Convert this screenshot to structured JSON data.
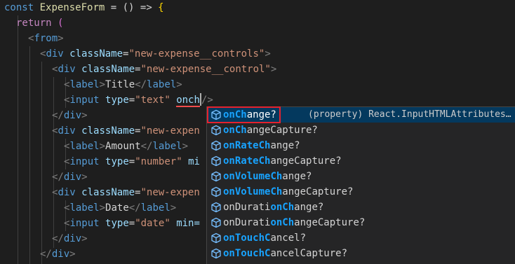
{
  "code": {
    "l1_kw": "const",
    "l1_name": "ExpenseForm",
    "l1_rest": " = () => ",
    "l1_brace": "{",
    "l2_kw": "return",
    "l2_paren": "(",
    "l3_tag": "from",
    "l4_tag": "div",
    "l4_attr": "className",
    "l4_val": "\"new-expense__controls\"",
    "l5_tag": "div",
    "l5_attr": "className",
    "l5_val": "\"new-expense__control\"",
    "l6_tag": "label",
    "l6_text": "Title",
    "l7_tag": "input",
    "l7_attr": "type",
    "l7_val": "\"text\"",
    "l7_typed": "onch",
    "l8_tag": "div",
    "l9_tag": "div",
    "l9_attr": "className",
    "l9_val": "\"new-expen",
    "l10_tag": "label",
    "l10_text": "Amount",
    "l11_tag": "input",
    "l11_attr": "type",
    "l11_val": "\"number\"",
    "l11_cut": "mi",
    "l12_tag": "div",
    "l13_tag": "div",
    "l13_attr": "className",
    "l13_val": "\"new-expen",
    "l14_tag": "label",
    "l14_text": "Date",
    "l15_tag": "input",
    "l15_attr": "type",
    "l15_val": "\"date\"",
    "l15_cut": "min=",
    "l16_tag": "div",
    "l17_tag": "div"
  },
  "suggestions": {
    "icon": "property-cube-icon",
    "detail": "(property) React.InputHTMLAttributes…",
    "items": [
      {
        "pre": "",
        "hl": "onCh",
        "post": "ange?"
      },
      {
        "pre": "",
        "hl": "onCh",
        "post": "angeCapture?"
      },
      {
        "pre": "onRate",
        "hl": "Ch",
        "post": "ange?"
      },
      {
        "pre": "onRate",
        "hl": "Ch",
        "post": "angeCapture?"
      },
      {
        "pre": "onVolume",
        "hl": "Ch",
        "post": "ange?"
      },
      {
        "pre": "onVolume",
        "hl": "Ch",
        "post": "angeCapture?"
      },
      {
        "pre": "onDurati",
        "hl": "onCh",
        "post": "ange?"
      },
      {
        "pre": "onDurati",
        "hl": "onCh",
        "post": "angeCapture?"
      },
      {
        "pre": "",
        "hl": "onTouchC",
        "post": "ancel?"
      },
      {
        "pre": "",
        "hl": "onTouchC",
        "post": "ancelCapture?"
      }
    ]
  },
  "colors": {
    "background": "#1e1e1e",
    "selection": "#04395e",
    "highlight": "#18a3ff",
    "highlight_box": "#e5222e"
  }
}
